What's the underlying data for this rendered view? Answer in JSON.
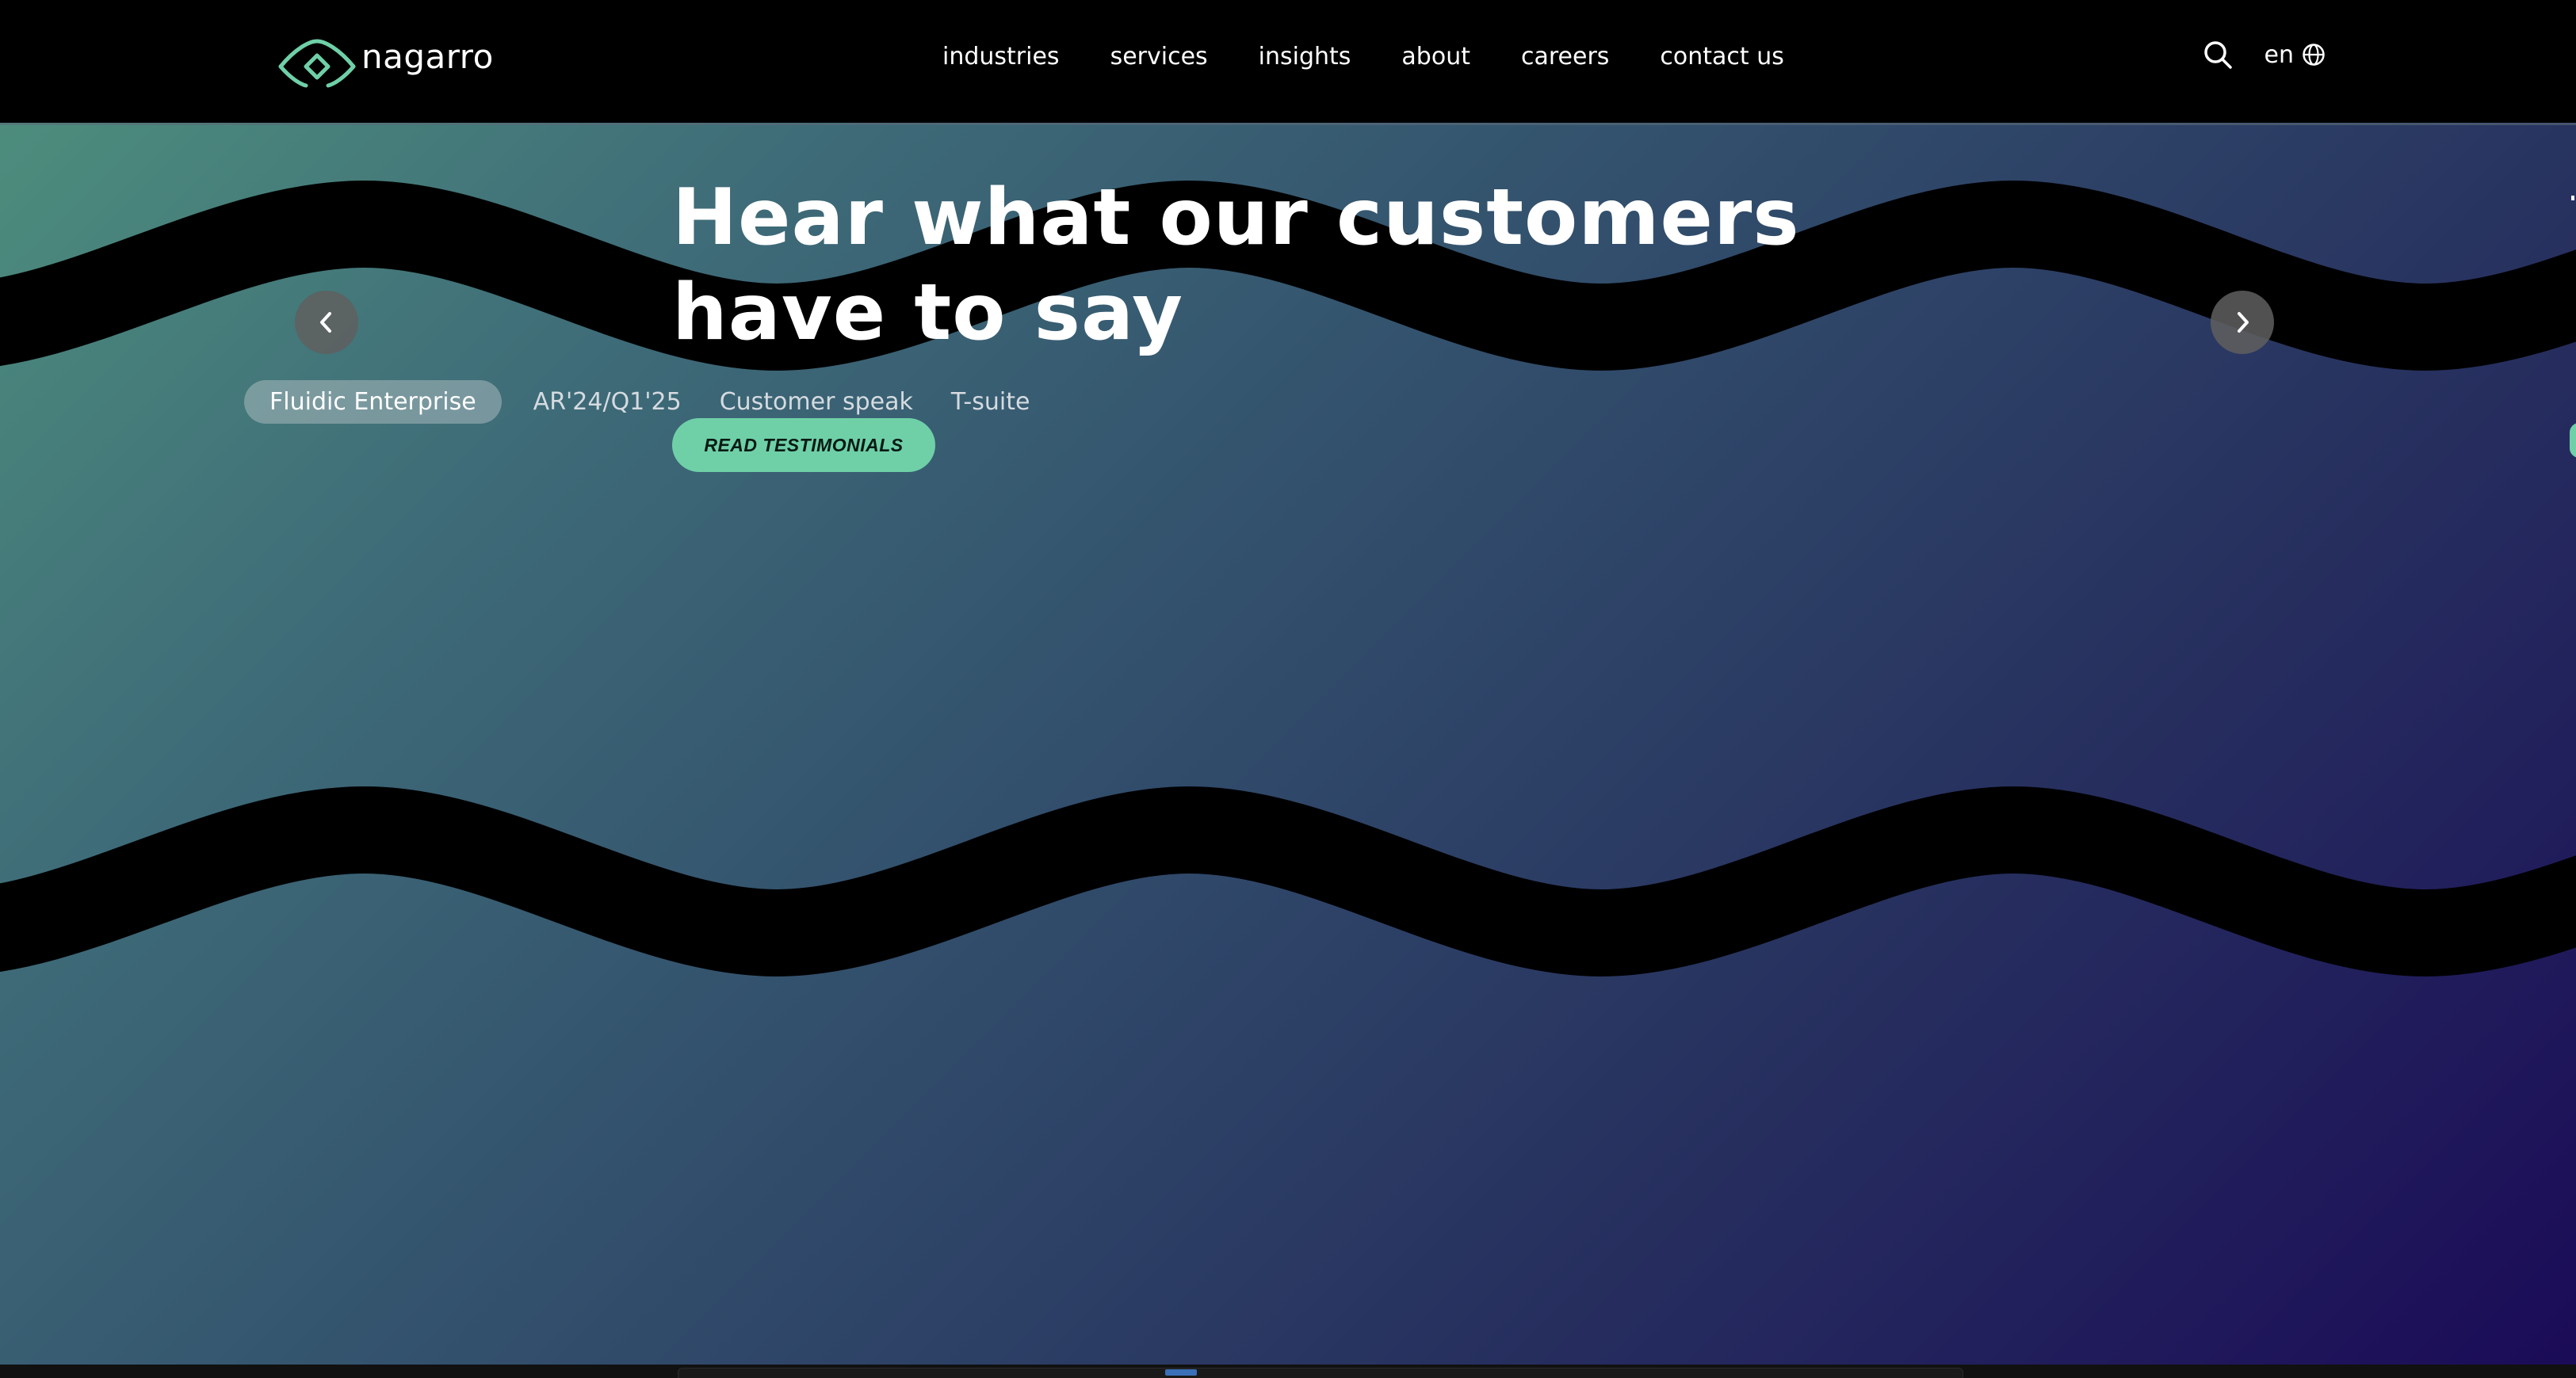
{
  "brand": {
    "name": "nagarro",
    "accent_color": "#6fd0a8",
    "icon": "diamond-eye-logo-icon"
  },
  "nav": {
    "items": [
      {
        "label": "industries"
      },
      {
        "label": "services"
      },
      {
        "label": "insights"
      },
      {
        "label": "about"
      },
      {
        "label": "careers"
      },
      {
        "label": "contact us"
      }
    ]
  },
  "tools": {
    "search_icon": "search-icon",
    "language": "en",
    "language_icon": "globe-icon"
  },
  "hero": {
    "headline": "Hear what our customers have to say",
    "prev_icon": "chevron-left-icon",
    "next_icon": "chevron-right-icon",
    "tabs": [
      {
        "label": "Fluidic Enterprise",
        "active": true
      },
      {
        "label": "AR'24/Q1'25",
        "active": false
      },
      {
        "label": "Customer speak",
        "active": false
      },
      {
        "label": "T-suite",
        "active": false
      }
    ],
    "cta_label": "READ TESTIMONIALS",
    "gradient_colors": [
      "#4d8d7d",
      "#324f6c",
      "#1b0b58"
    ]
  }
}
